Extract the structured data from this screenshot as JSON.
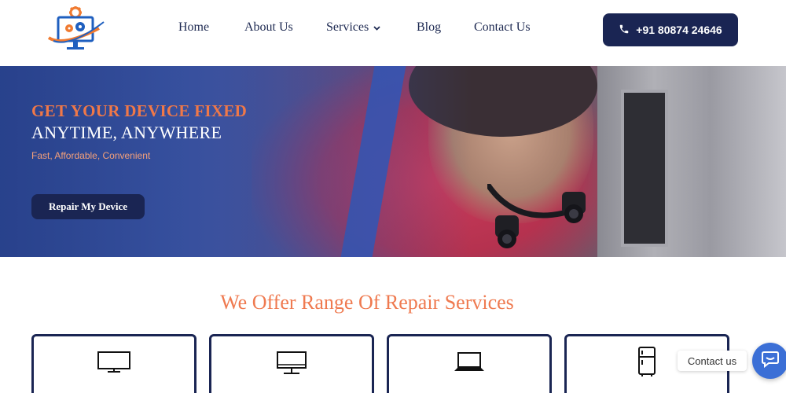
{
  "colors": {
    "navy": "#1a2553",
    "accent_orange": "#ef7a50",
    "hero_blue": "#3d5aa3",
    "widget_blue": "#3b6fd6"
  },
  "header": {
    "logo_icon": "computer-gear-logo",
    "nav": [
      {
        "label": "Home"
      },
      {
        "label": "About Us"
      },
      {
        "label": "Services",
        "has_dropdown": true
      },
      {
        "label": "Blog"
      },
      {
        "label": "Contact Us"
      }
    ],
    "phone_icon": "phone-icon",
    "phone_label": "+91 80874 24646"
  },
  "hero": {
    "title_line1": "GET YOUR DEVICE FIXED",
    "title_line2": "ANYTIME, ANYWHERE",
    "subtitle": "Fast, Affordable, Convenient",
    "cta_label": "Repair My Device"
  },
  "services": {
    "title": "We Offer Range Of Repair Services",
    "cards": [
      {
        "icon": "tv-icon"
      },
      {
        "icon": "monitor-icon"
      },
      {
        "icon": "laptop-icon"
      },
      {
        "icon": "refrigerator-icon"
      }
    ]
  },
  "contact_widget": {
    "label": "Contact us",
    "icon": "chat-icon"
  }
}
